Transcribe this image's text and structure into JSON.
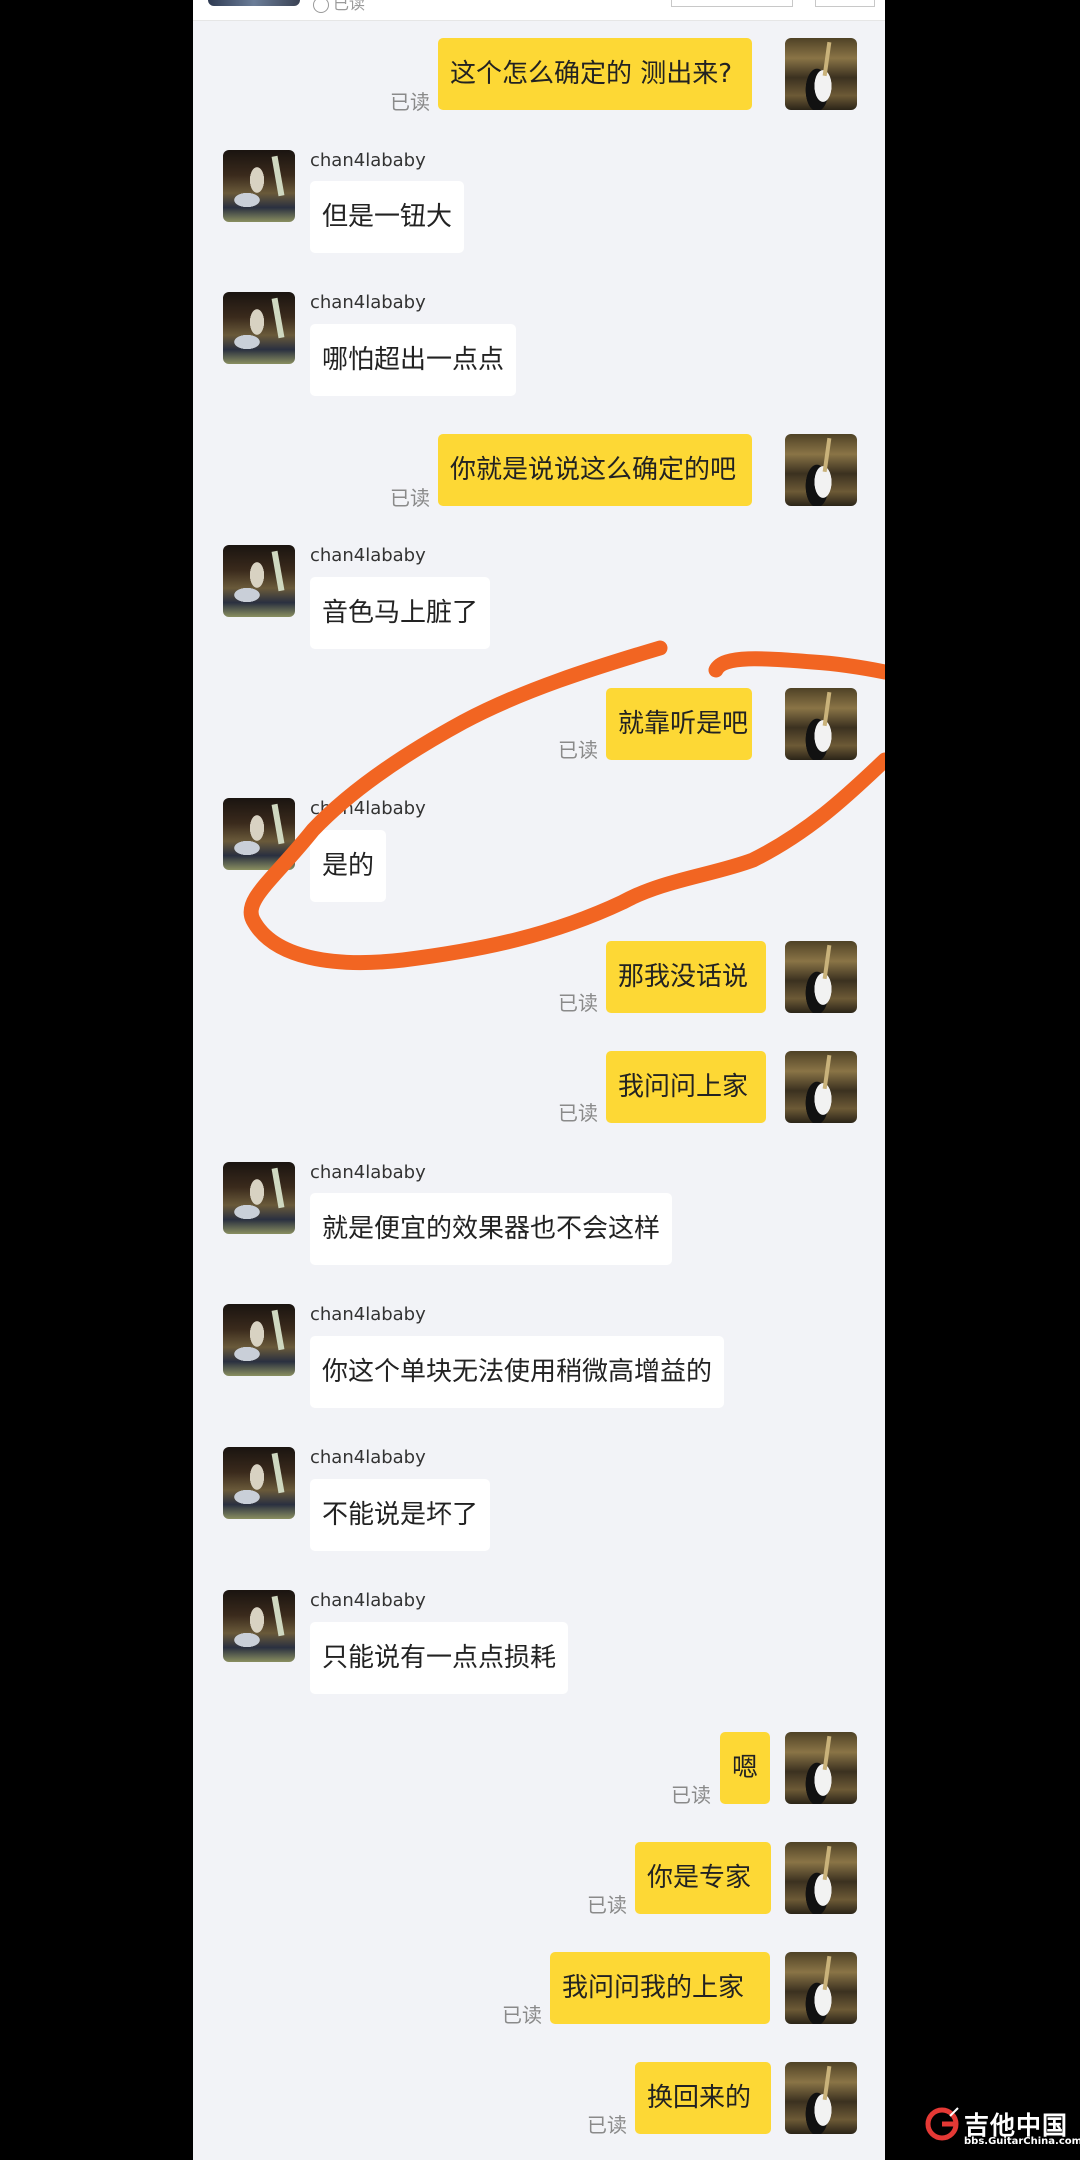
{
  "topbar": {
    "status": "已读"
  },
  "messages": [
    {
      "side": "out",
      "text": "这个怎么确定的 测出来?",
      "read": "已读"
    },
    {
      "side": "in",
      "sender": "chan4lababy",
      "text": "但是一钮大"
    },
    {
      "side": "in",
      "sender": "chan4lababy",
      "text": "哪怕超出一点点"
    },
    {
      "side": "out",
      "text": "你就是说说这么确定的吧",
      "read": "已读"
    },
    {
      "side": "in",
      "sender": "chan4lababy",
      "text": "音色马上脏了"
    },
    {
      "side": "out",
      "text": "就靠听是吧",
      "read": "已读"
    },
    {
      "side": "in",
      "sender": "chan4lababy",
      "text": "是的"
    },
    {
      "side": "out",
      "text": "那我没话说",
      "read": "已读"
    },
    {
      "side": "out",
      "text": "我问问上家",
      "read": "已读"
    },
    {
      "side": "in",
      "sender": "chan4lababy",
      "text": "就是便宜的效果器也不会这样"
    },
    {
      "side": "in",
      "sender": "chan4lababy",
      "text": "你这个单块无法使用稍微高增益的"
    },
    {
      "side": "in",
      "sender": "chan4lababy",
      "text": "不能说是坏了"
    },
    {
      "side": "in",
      "sender": "chan4lababy",
      "text": "只能说有一点点损耗"
    },
    {
      "side": "out",
      "text": "嗯",
      "read": "已读"
    },
    {
      "side": "out",
      "text": "你是专家",
      "read": "已读"
    },
    {
      "side": "out",
      "text": "我问问我的上家",
      "read": "已读"
    },
    {
      "side": "out",
      "text": "换回来的",
      "read": "已读"
    }
  ],
  "annotation": {
    "color": "#f26522"
  },
  "watermark": {
    "title": "吉他中国",
    "url": "bbs.GuitarChina.com"
  },
  "colors": {
    "outgoing_bubble": "#fdd835",
    "incoming_bubble": "#ffffff",
    "background": "#f2f3f7"
  }
}
